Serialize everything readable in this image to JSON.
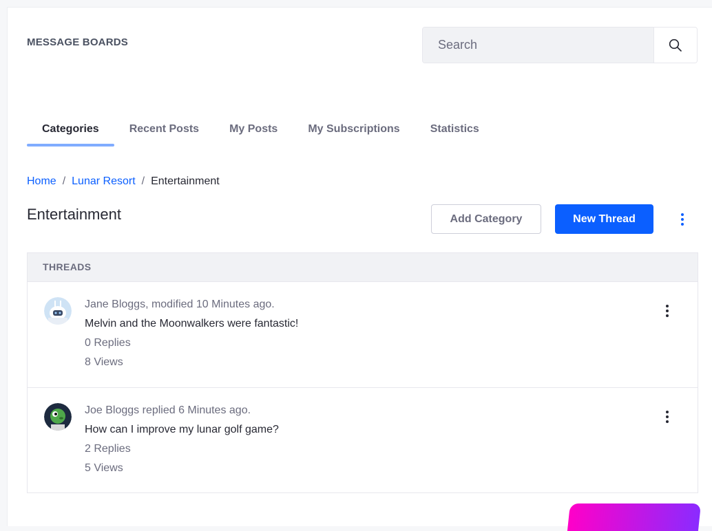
{
  "header": {
    "app_title": "MESSAGE BOARDS",
    "search_placeholder": "Search",
    "search_icon": "search-icon"
  },
  "tabs": [
    {
      "label": "Categories",
      "active": true
    },
    {
      "label": "Recent Posts",
      "active": false
    },
    {
      "label": "My Posts",
      "active": false
    },
    {
      "label": "My Subscriptions",
      "active": false
    },
    {
      "label": "Statistics",
      "active": false
    }
  ],
  "breadcrumb": {
    "items": [
      "Home",
      "Lunar Resort"
    ],
    "separator": "/",
    "current": "Entertainment"
  },
  "page": {
    "title": "Entertainment",
    "add_category_label": "Add Category",
    "new_thread_label": "New Thread",
    "more_icon": "kebab-icon"
  },
  "threads": {
    "header": "THREADS",
    "items": [
      {
        "meta": "Jane Bloggs, modified 10 Minutes ago.",
        "title": "Melvin and the Moonwalkers were fantastic!",
        "replies": "0 Replies",
        "views": "8 Views",
        "avatar_icon": "astronaut-avatar"
      },
      {
        "meta": "Joe Bloggs replied 6 Minutes ago.",
        "title": "How can I improve my lunar golf game?",
        "replies": "2 Replies",
        "views": "5 Views",
        "avatar_icon": "alien-avatar"
      }
    ]
  },
  "colors": {
    "primary": "#0b5fff",
    "tab_indicator": "#80acff",
    "text_dark": "#272833",
    "text_muted": "#6b6c7e"
  }
}
